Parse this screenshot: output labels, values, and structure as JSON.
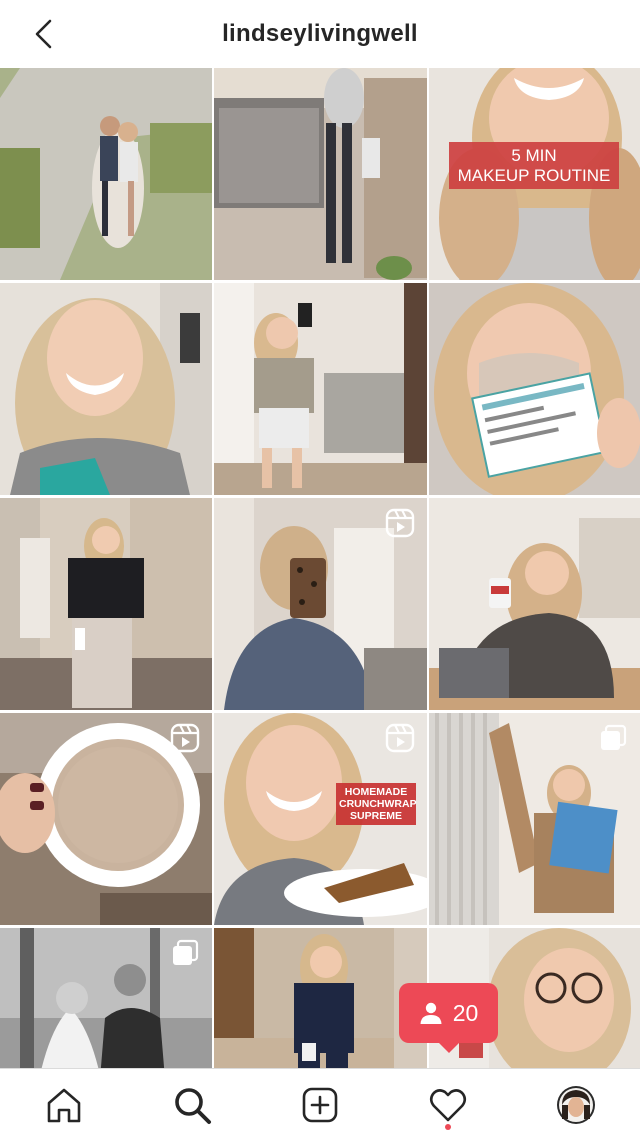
{
  "header": {
    "username": "lindseylivingwell",
    "back_icon": "chevron-left-icon"
  },
  "grid": {
    "posts": [
      {
        "id": "post-1",
        "overlay": "",
        "badge": ""
      },
      {
        "id": "post-2",
        "overlay": "",
        "badge": ""
      },
      {
        "id": "post-3",
        "overlay": "5 MIN\nMAKEUP ROUTINE",
        "badge": ""
      },
      {
        "id": "post-4",
        "overlay": "",
        "badge": ""
      },
      {
        "id": "post-5",
        "overlay": "",
        "badge": ""
      },
      {
        "id": "post-6",
        "overlay": "",
        "badge": ""
      },
      {
        "id": "post-7",
        "overlay": "",
        "badge": ""
      },
      {
        "id": "post-8",
        "overlay": "",
        "badge": "reels-icon"
      },
      {
        "id": "post-9",
        "overlay": "",
        "badge": ""
      },
      {
        "id": "post-10",
        "overlay": "",
        "badge": "reels-icon"
      },
      {
        "id": "post-11",
        "overlay": "HOMEMADE\nCRUNCHWRAP\nSUPREME",
        "badge": "reels-icon"
      },
      {
        "id": "post-12",
        "overlay": "",
        "badge": "carousel-icon"
      },
      {
        "id": "post-13",
        "overlay": "",
        "badge": "carousel-icon"
      },
      {
        "id": "post-14",
        "overlay": "",
        "badge": ""
      },
      {
        "id": "post-15",
        "overlay": "",
        "badge": ""
      }
    ]
  },
  "notification": {
    "count": "20",
    "icon": "person-icon",
    "color": "#ed4956"
  },
  "bottom_nav": {
    "items": [
      {
        "name": "home",
        "icon": "home-icon"
      },
      {
        "name": "search",
        "icon": "search-icon"
      },
      {
        "name": "create",
        "icon": "plus-square-icon"
      },
      {
        "name": "activity",
        "icon": "heart-icon"
      },
      {
        "name": "profile",
        "icon": "avatar"
      }
    ]
  }
}
